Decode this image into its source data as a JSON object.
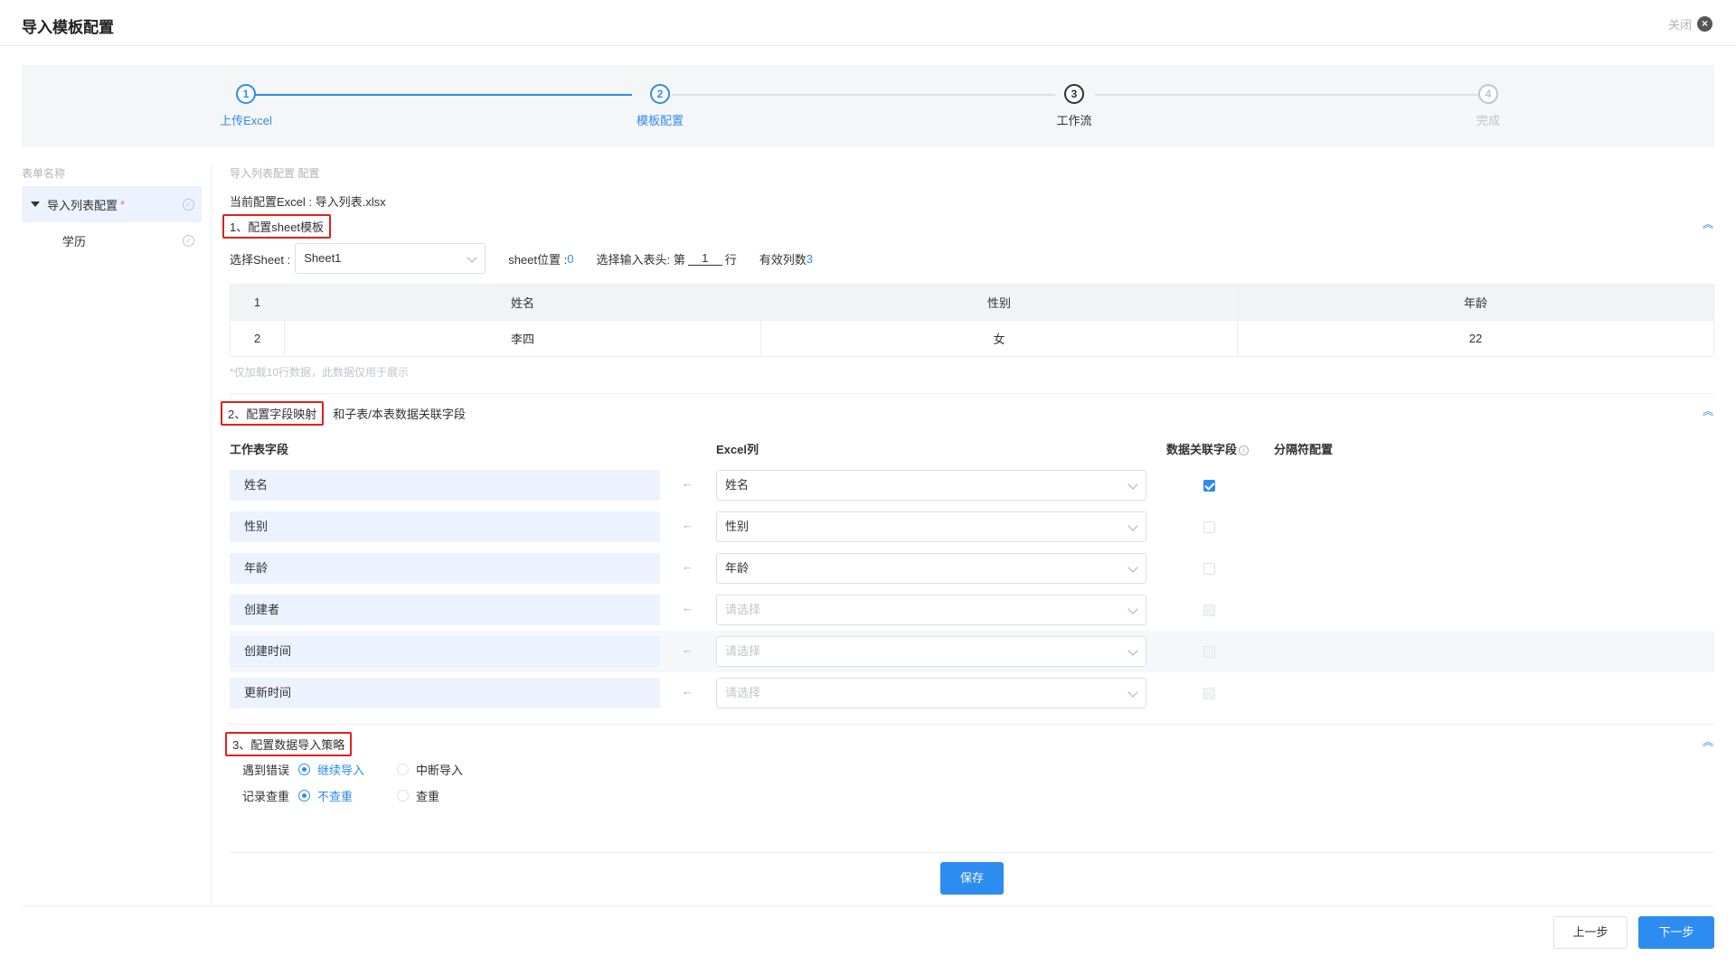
{
  "header": {
    "title": "导入模板配置",
    "close_label": "关闭"
  },
  "steps": [
    {
      "num": "1",
      "label": "上传Excel",
      "state": "done"
    },
    {
      "num": "2",
      "label": "模板配置",
      "state": "active"
    },
    {
      "num": "3",
      "label": "工作流",
      "state": "current"
    },
    {
      "num": "4",
      "label": "完成",
      "state": "pending"
    }
  ],
  "sidebar": {
    "title": "表单名称",
    "items": [
      {
        "label": "导入列表配置",
        "required_mark": "*"
      },
      {
        "label": "学历"
      }
    ]
  },
  "main": {
    "crumb": "导入列表配置 配置",
    "current_excel_label": "当前配置Excel : ",
    "current_excel_file": "导入列表.xlsx"
  },
  "section1": {
    "title": "1、配置sheet模板",
    "select_sheet_label": "选择Sheet :",
    "sheet_value": "Sheet1",
    "sheet_pos_label": "sheet位置 : ",
    "sheet_pos_value": "0",
    "header_row_prefix": "选择输入表头: 第",
    "header_row_value": "1",
    "header_row_suffix": "行",
    "valid_cols_label": "有效列数 ",
    "valid_cols_value": "3",
    "table": {
      "header": [
        "1",
        "姓名",
        "性别",
        "年龄"
      ],
      "rows": [
        [
          "2",
          "李四",
          "女",
          "22"
        ]
      ]
    },
    "note": "*仅加载10行数据，此数据仅用于展示"
  },
  "section2": {
    "title": "2、配置字段映射",
    "subtitle": "和子表/本表数据关联字段",
    "col_field": "工作表字段",
    "col_excel": "Excel列",
    "col_relation": "数据关联字段",
    "col_separator": "分隔符配置",
    "placeholder": "请选择",
    "rows": [
      {
        "field": "姓名",
        "excel": "姓名",
        "checked": true
      },
      {
        "field": "性别",
        "excel": "性别",
        "checked": false
      },
      {
        "field": "年龄",
        "excel": "年龄",
        "checked": false
      },
      {
        "field": "创建者",
        "excel": "",
        "checked": false
      },
      {
        "field": "创建时间",
        "excel": "",
        "checked": false
      },
      {
        "field": "更新时间",
        "excel": "",
        "checked": false
      }
    ]
  },
  "section3": {
    "title": "3、配置数据导入策略",
    "error_label": "遇到错误",
    "error_opt1": "继续导入",
    "error_opt2": "中断导入",
    "dup_label": "记录查重",
    "dup_opt1": "不查重",
    "dup_opt2": "查重"
  },
  "buttons": {
    "save": "保存",
    "prev": "上一步",
    "next": "下一步"
  },
  "colors": {
    "primary": "#2d8cf0",
    "highlight_border": "#e02020"
  }
}
